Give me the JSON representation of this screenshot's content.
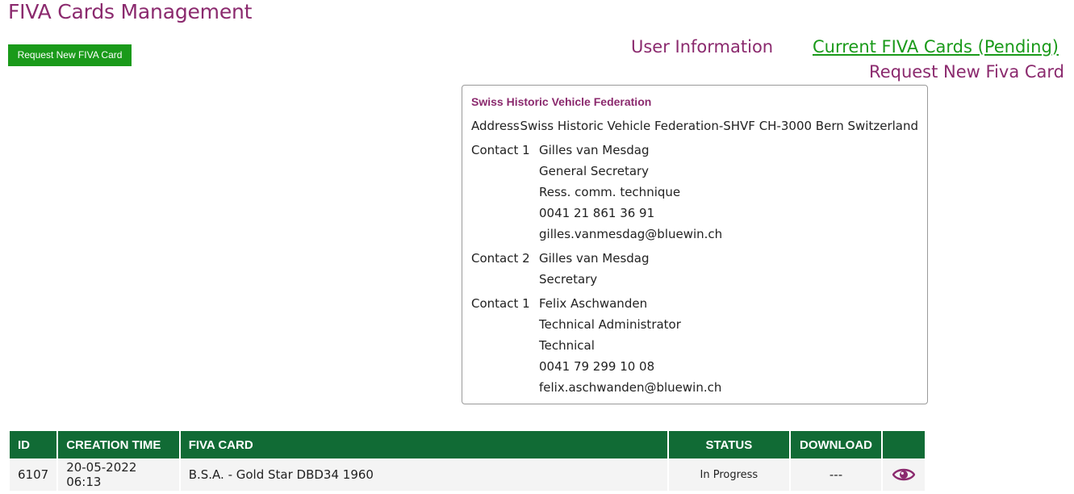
{
  "page": {
    "title": "FIVA Cards Management"
  },
  "actions": {
    "request_button_label": "Request New FIVA Card"
  },
  "nav": {
    "user_information": "User Information",
    "current_cards": "Current FIVA Cards (Pending)",
    "request_new": "Request New Fiva Card"
  },
  "info": {
    "org_name": "Swiss Historic Vehicle Federation",
    "address_label": "Address",
    "address": "Swiss Historic Vehicle Federation-SHVF CH-3000 Bern Switzerland",
    "contacts": [
      {
        "label": "Contact 1",
        "lines": [
          "Gilles van Mesdag",
          "General Secretary",
          "Ress. comm. technique",
          "0041 21 861 36 91",
          "gilles.vanmesdag@bluewin.ch"
        ]
      },
      {
        "label": "Contact 2",
        "lines": [
          "Gilles van Mesdag",
          "Secretary"
        ]
      },
      {
        "label": "Contact 1",
        "lines": [
          "Felix Aschwanden",
          "Technical Administrator",
          "Technical",
          "0041 79 299 10 08",
          "felix.aschwanden@bluewin.ch"
        ]
      }
    ]
  },
  "table": {
    "headers": [
      "ID",
      "CREATION TIME",
      "FIVA CARD",
      "STATUS",
      "DOWNLOAD",
      ""
    ],
    "rows": [
      {
        "id": "6107",
        "created": "20-05-2022 06:13",
        "card": "B.S.A. - Gold Star DBD34 1960",
        "status": "In Progress",
        "download": "---",
        "view_icon": "eye-icon"
      }
    ]
  },
  "colors": {
    "accent": "#8b2a6e",
    "green": "#1a9a1a",
    "header_green": "#116b35"
  }
}
